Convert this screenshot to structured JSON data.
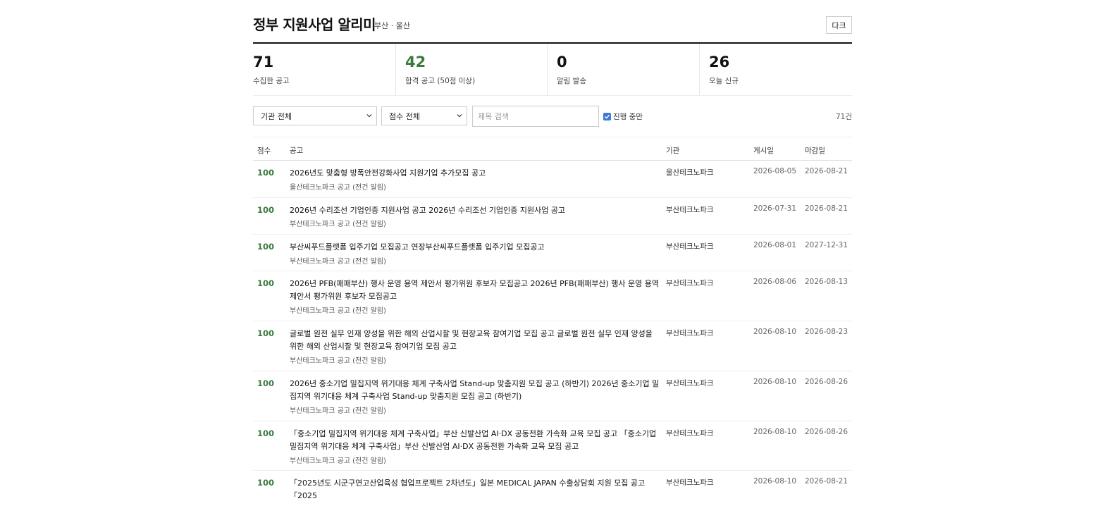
{
  "header": {
    "title": "정부 지원사업 알리미",
    "subtitle": "부산 · 울산",
    "dark_button": "다크"
  },
  "stats": [
    {
      "value": "71",
      "label": "수집한 공고",
      "accent": false
    },
    {
      "value": "42",
      "label": "합격 공고 (50점 이상)",
      "accent": true
    },
    {
      "value": "0",
      "label": "알림 발송",
      "accent": false
    },
    {
      "value": "26",
      "label": "오늘 신규",
      "accent": false
    }
  ],
  "filters": {
    "agency_select": "기관 전체",
    "score_select": "점수 전체",
    "search_placeholder": "제목 검색",
    "search_value": "",
    "ongoing_label": "진행 중만",
    "ongoing_checked": true,
    "result_count": "71건"
  },
  "table": {
    "headers": {
      "score": "점수",
      "notice": "공고",
      "agency": "기관",
      "posted": "게시일",
      "deadline": "마감일"
    },
    "rows": [
      {
        "score": "100",
        "title": "2026년도 맞춤형 방폭안전강화사업 지원기업 추가모집 공고",
        "desc": "울산테크노파크 공고 (전건 알림)",
        "agency": "울산테크노파크",
        "posted": "2026-08-05",
        "deadline": "2026-08-21"
      },
      {
        "score": "100",
        "title": "2026년 수리조선 기업인증 지원사업 공고 2026년 수리조선 기업인증 지원사업 공고",
        "desc": "부산테크노파크 공고 (전건 알림)",
        "agency": "부산테크노파크",
        "posted": "2026-07-31",
        "deadline": "2026-08-21"
      },
      {
        "score": "100",
        "title": "부산씨푸드플랫폼 입주기업 모집공고 연장부산씨푸드플랫폼 입주기업 모집공고",
        "desc": "부산테크노파크 공고 (전건 알림)",
        "agency": "부산테크노파크",
        "posted": "2026-08-01",
        "deadline": "2027-12-31"
      },
      {
        "score": "100",
        "title": "2026년 PFB(패패부산) 행사 운영 용역 제안서 평가위원 후보자 모집공고 2026년 PFB(패패부산) 행사 운영 용역 제안서 평가위원 후보자 모집공고",
        "desc": "부산테크노파크 공고 (전건 알림)",
        "agency": "부산테크노파크",
        "posted": "2026-08-06",
        "deadline": "2026-08-13"
      },
      {
        "score": "100",
        "title": "글로벌 원전 실무 인재 양성을 위한 해외 산업시찰 및 현장교육 참여기업 모집 공고 글로벌 원전 실무 인재 양성을 위한 해외 산업시찰 및 현장교육 참여기업 모집 공고",
        "desc": "부산테크노파크 공고 (전건 알림)",
        "agency": "부산테크노파크",
        "posted": "2026-08-10",
        "deadline": "2026-08-23"
      },
      {
        "score": "100",
        "title": "2026년 중소기업 밀집지역 위기대응 체계 구축사업 Stand-up 맞춤지원 모집 공고 (하반기) 2026년 중소기업 밀집지역 위기대응 체계 구축사업 Stand-up 맞춤지원 모집 공고 (하반기)",
        "desc": "부산테크노파크 공고 (전건 알림)",
        "agency": "부산테크노파크",
        "posted": "2026-08-10",
        "deadline": "2026-08-26"
      },
      {
        "score": "100",
        "title": "「중소기업 밀집지역 위기대응 체계 구축사업」부산 신발산업 AI·DX 공동전환 가속화 교육 모집 공고 「중소기업 밀집지역 위기대응 체계 구축사업」부산 신발산업 AI·DX 공동전환 가속화 교육 모집 공고",
        "desc": "부산테크노파크 공고 (전건 알림)",
        "agency": "부산테크노파크",
        "posted": "2026-08-10",
        "deadline": "2026-08-26"
      },
      {
        "score": "100",
        "title": "「2025년도 시군구연고산업육성 협업프로젝트 2차년도」일본 MEDICAL JAPAN 수출상담회 지원 모집 공고 「2025",
        "desc": "",
        "agency": "부산테크노파크",
        "posted": "2026-08-10",
        "deadline": "2026-08-21"
      }
    ]
  },
  "colors": {
    "accent_green": "#3a7a3e",
    "checkbox_blue": "#3b7bd6"
  }
}
